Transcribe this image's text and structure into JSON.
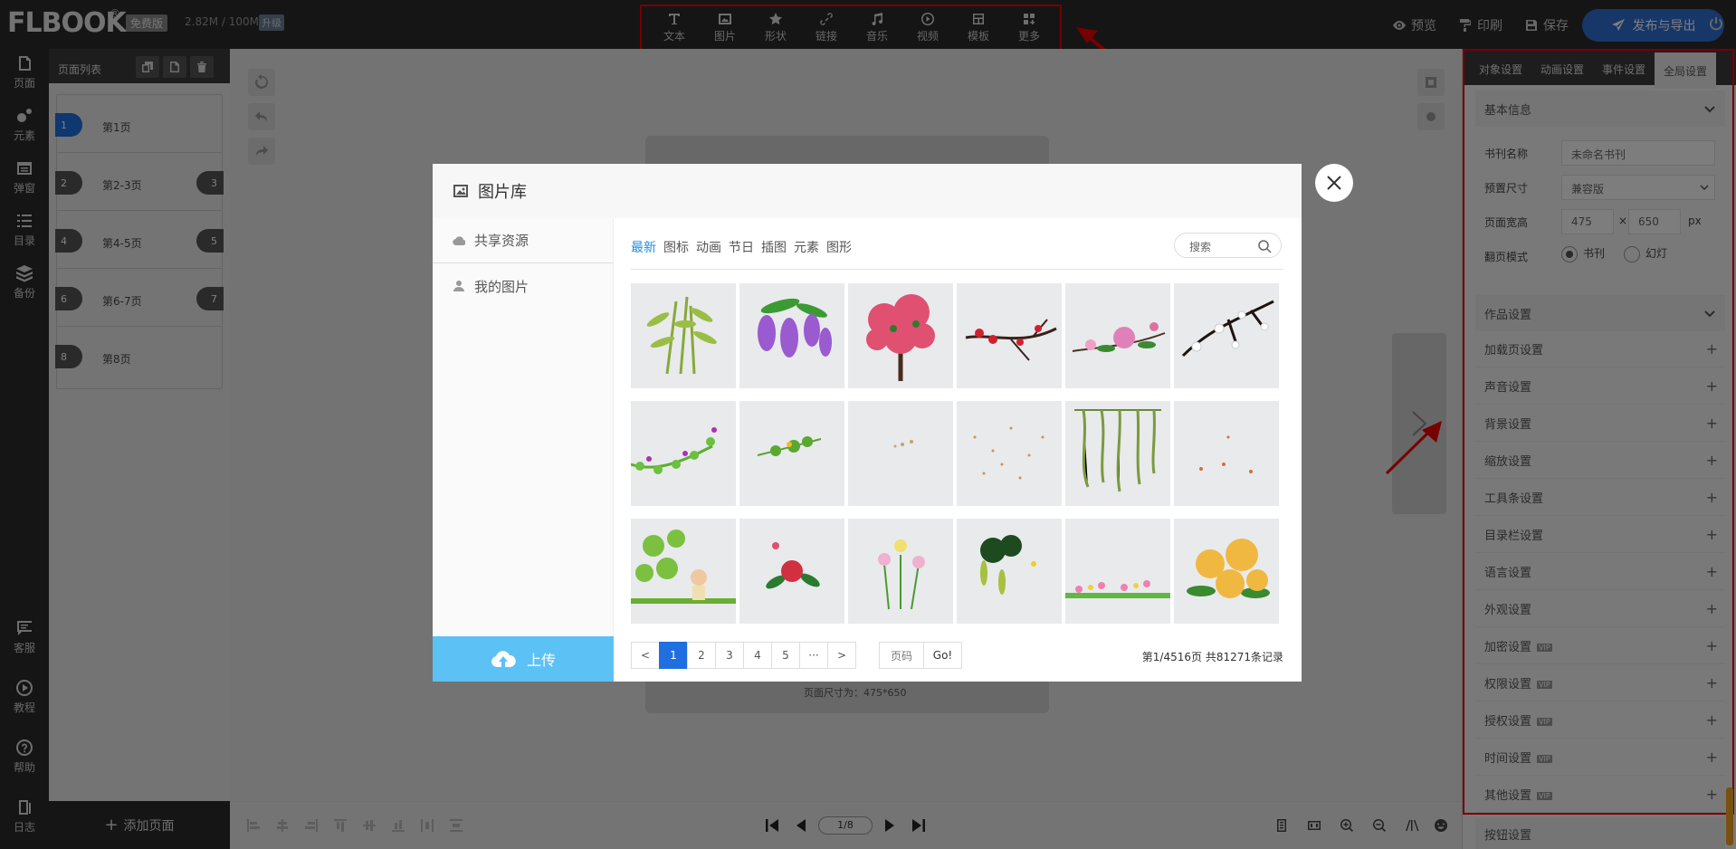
{
  "app": {
    "logo": "FLBOOK",
    "logo_reg": "®",
    "edition_badge": "免费版",
    "storage": "2.82M / 100M",
    "upgrade": "升级"
  },
  "toolbar": {
    "items": [
      {
        "label": "文本",
        "icon": "text-icon"
      },
      {
        "label": "图片",
        "icon": "image-icon"
      },
      {
        "label": "形状",
        "icon": "star-icon"
      },
      {
        "label": "链接",
        "icon": "link-icon"
      },
      {
        "label": "音乐",
        "icon": "music-icon"
      },
      {
        "label": "视频",
        "icon": "video-icon"
      },
      {
        "label": "模板",
        "icon": "template-icon"
      },
      {
        "label": "更多",
        "icon": "more-icon"
      }
    ],
    "preview": "预览",
    "print": "印刷",
    "save": "保存",
    "publish": "发布与导出"
  },
  "left_nav": {
    "items": [
      {
        "label": "页面",
        "icon": "page-icon"
      },
      {
        "label": "元素",
        "icon": "elements-icon"
      },
      {
        "label": "弹窗",
        "icon": "popup-icon"
      },
      {
        "label": "目录",
        "icon": "toc-icon"
      },
      {
        "label": "备份",
        "icon": "backup-icon"
      }
    ],
    "bottom": [
      {
        "label": "客服",
        "icon": "chat-icon"
      },
      {
        "label": "教程",
        "icon": "play-icon"
      },
      {
        "label": "帮助",
        "icon": "help-icon"
      },
      {
        "label": "日志",
        "icon": "log-icon"
      }
    ]
  },
  "page_list": {
    "title": "页面列表",
    "pages": [
      {
        "label": "第1页",
        "left": "1",
        "right": "",
        "active": true
      },
      {
        "label": "第2-3页",
        "left": "2",
        "right": "3",
        "active": false
      },
      {
        "label": "第4-5页",
        "left": "4",
        "right": "5",
        "active": false
      },
      {
        "label": "第6-7页",
        "left": "6",
        "right": "7",
        "active": false
      },
      {
        "label": "第8页",
        "left": "8",
        "right": "",
        "active": false
      }
    ],
    "add_page": "添加页面"
  },
  "canvas": {
    "page_size": "页面尺寸为：475*650",
    "page_indicator": "1/8"
  },
  "modal": {
    "title": "图片库",
    "sidebar": [
      {
        "label": "共享资源",
        "icon": "cloud-icon"
      },
      {
        "label": "我的图片",
        "icon": "user-icon"
      }
    ],
    "upload": "上传",
    "categories": [
      "最新",
      "图标",
      "动画",
      "节日",
      "插图",
      "元素",
      "图形"
    ],
    "active_category": "最新",
    "search_placeholder": "搜索",
    "pagination": {
      "prev": "<",
      "pages": [
        "1",
        "2",
        "3",
        "4",
        "5"
      ],
      "ellipsis": "···",
      "next": ">",
      "active": "1",
      "page_input": "页码",
      "go": "Go!",
      "summary": "第1/4516页 共81271条记录"
    }
  },
  "right_panel": {
    "tabs": [
      "对象设置",
      "动画设置",
      "事件设置",
      "全局设置"
    ],
    "active_tab": "全局设置",
    "basic_info": {
      "title": "基本信息",
      "book_name_label": "书刊名称",
      "book_name_value": "未命名书刊",
      "preset_label": "预置尺寸",
      "preset_value": "兼容版",
      "size_label": "页面宽高",
      "width": "475",
      "times": "×",
      "height": "650",
      "unit": "px",
      "flip_label": "翻页模式",
      "flip_options": [
        "书刊",
        "幻灯"
      ]
    },
    "work_settings": {
      "title": "作品设置",
      "items": [
        {
          "label": "加载页设置",
          "vip": false
        },
        {
          "label": "声音设置",
          "vip": false
        },
        {
          "label": "背景设置",
          "vip": false
        },
        {
          "label": "缩放设置",
          "vip": false
        },
        {
          "label": "工具条设置",
          "vip": false
        },
        {
          "label": "目录栏设置",
          "vip": false
        },
        {
          "label": "语言设置",
          "vip": false
        },
        {
          "label": "外观设置",
          "vip": false
        },
        {
          "label": "加密设置",
          "vip": true
        },
        {
          "label": "权限设置",
          "vip": true
        },
        {
          "label": "授权设置",
          "vip": true
        },
        {
          "label": "时间设置",
          "vip": true
        },
        {
          "label": "其他设置",
          "vip": true
        }
      ],
      "vip_badge": "VIP",
      "next_section": "按钮设置"
    }
  },
  "colors": {
    "accent": "#1f6fe0",
    "annotation": "#e00000",
    "upload": "#5cc1f5",
    "dark": "#2b2b2b"
  }
}
